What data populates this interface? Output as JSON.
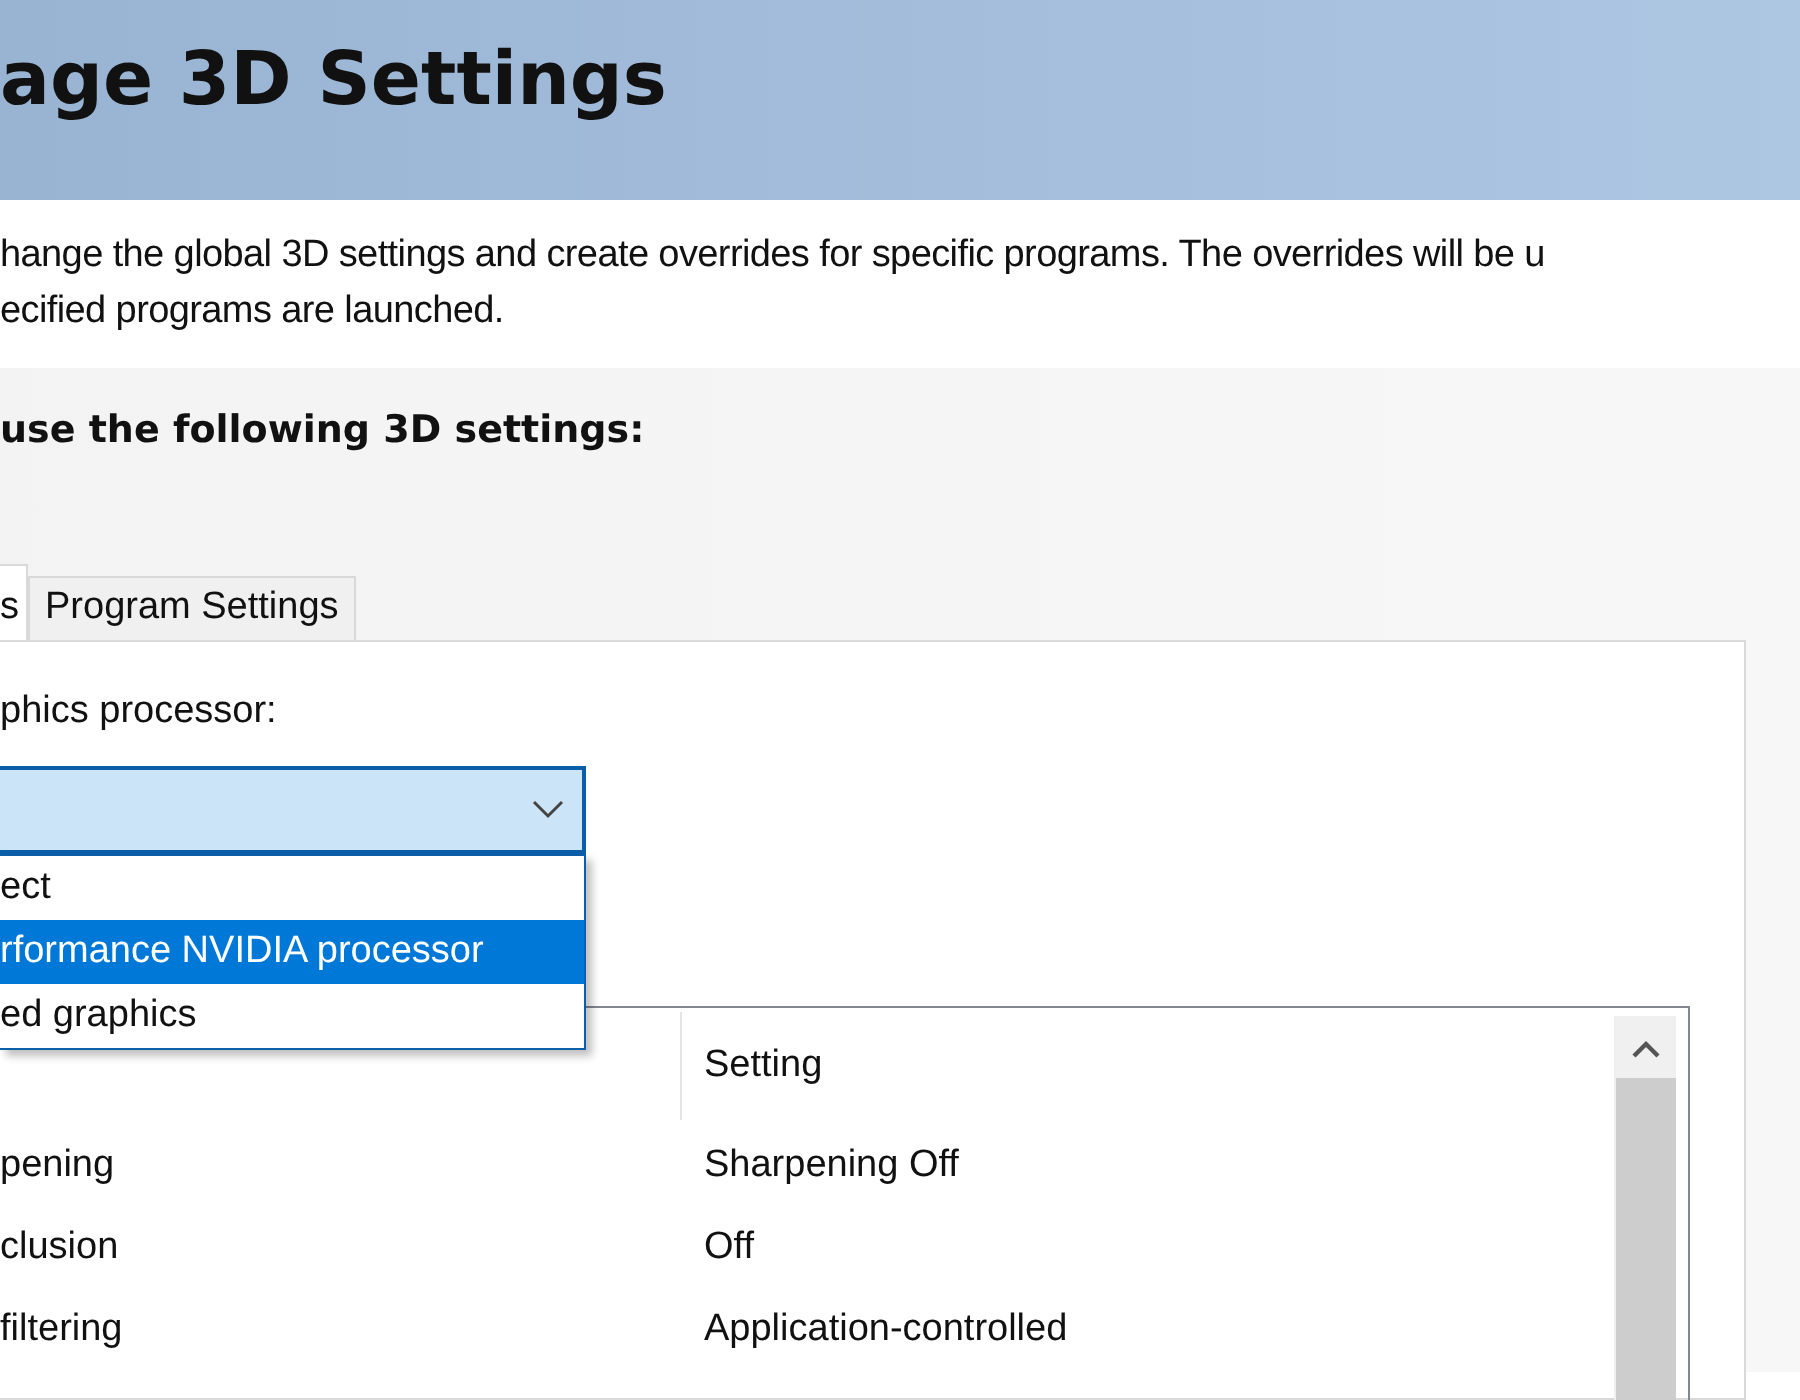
{
  "header": {
    "title": "age 3D Settings"
  },
  "description": [
    "hange the global 3D settings and create overrides for specific programs. The overrides will be u",
    "ecified programs are launched."
  ],
  "section_heading": "use the following 3D settings:",
  "tabs": [
    {
      "label": "s",
      "selected": true
    },
    {
      "label": "Program Settings",
      "selected": false
    }
  ],
  "processor": {
    "label": "phics processor:",
    "expanded": true,
    "options": [
      {
        "label": "ect",
        "selected": false
      },
      {
        "label": "rformance NVIDIA processor",
        "selected": true
      },
      {
        "label": "ed graphics",
        "selected": false
      }
    ]
  },
  "table": {
    "columns": [
      "Setting"
    ],
    "rows": [
      {
        "column_1": "pening",
        "setting": "Sharpening Off"
      },
      {
        "column_1": "clusion",
        "setting": "Off"
      },
      {
        "column_1": "filtering",
        "setting": "Application-controlled"
      }
    ]
  }
}
